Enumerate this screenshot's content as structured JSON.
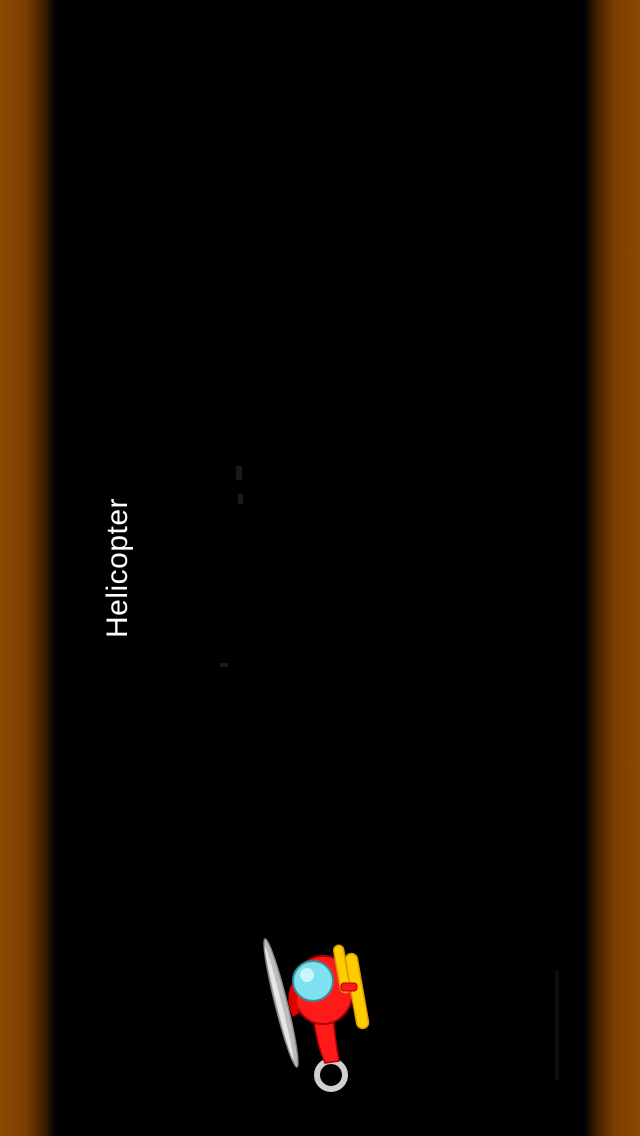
{
  "game": {
    "title": "Helicopter"
  },
  "colors": {
    "background": "#000000",
    "cave_wall": "#8a4a00",
    "helicopter_body": "#ff1a1a",
    "helicopter_rotor": "#ffcc00",
    "cockpit": "#7fe0f0",
    "propeller_blade": "#c8c8c8"
  },
  "icons": {
    "player": "helicopter-icon"
  }
}
